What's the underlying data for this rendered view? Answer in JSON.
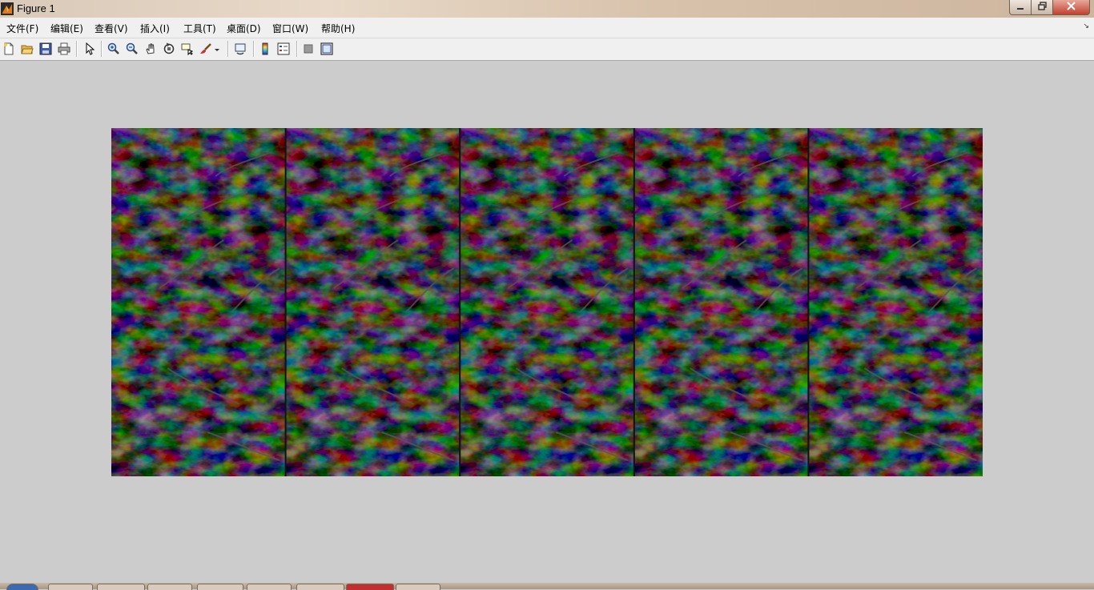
{
  "window": {
    "title": "Figure 1",
    "icon": "matlab-icon",
    "controls": [
      "minimize-icon",
      "restore-icon",
      "close-icon"
    ]
  },
  "menubar": {
    "items": [
      {
        "label": "文件(F)"
      },
      {
        "label": "编辑(E)"
      },
      {
        "label": "查看(V)"
      },
      {
        "label": "插入(I)"
      },
      {
        "label": "工具(T)"
      },
      {
        "label": "桌面(D)"
      },
      {
        "label": "窗口(W)"
      },
      {
        "label": "帮助(H)"
      }
    ]
  },
  "toolbar": {
    "buttons": [
      "new-figure-icon",
      "open-file-icon",
      "save-figure-icon",
      "print-figure-icon",
      "edit-plot-arrow-icon",
      "zoom-in-icon",
      "zoom-out-icon",
      "pan-hand-icon",
      "rotate-3d-icon",
      "data-cursor-icon",
      "brush-icon",
      "link-plot-icon",
      "insert-colorbar-icon",
      "insert-legend-icon",
      "hide-plot-tools-icon",
      "show-plot-tools-icon"
    ]
  },
  "figure": {
    "content": "image",
    "image_description": "grayscale repeating texture tiled five times horizontally",
    "tiles": 5,
    "colors": {
      "background": "#cccccc",
      "image_bg": "#000000"
    }
  },
  "taskbar": {
    "buttons": [
      "start-button",
      "taskbar-app",
      "taskbar-app",
      "taskbar-app",
      "taskbar-app",
      "taskbar-app",
      "taskbar-app",
      "taskbar-app",
      "taskbar-app"
    ]
  }
}
